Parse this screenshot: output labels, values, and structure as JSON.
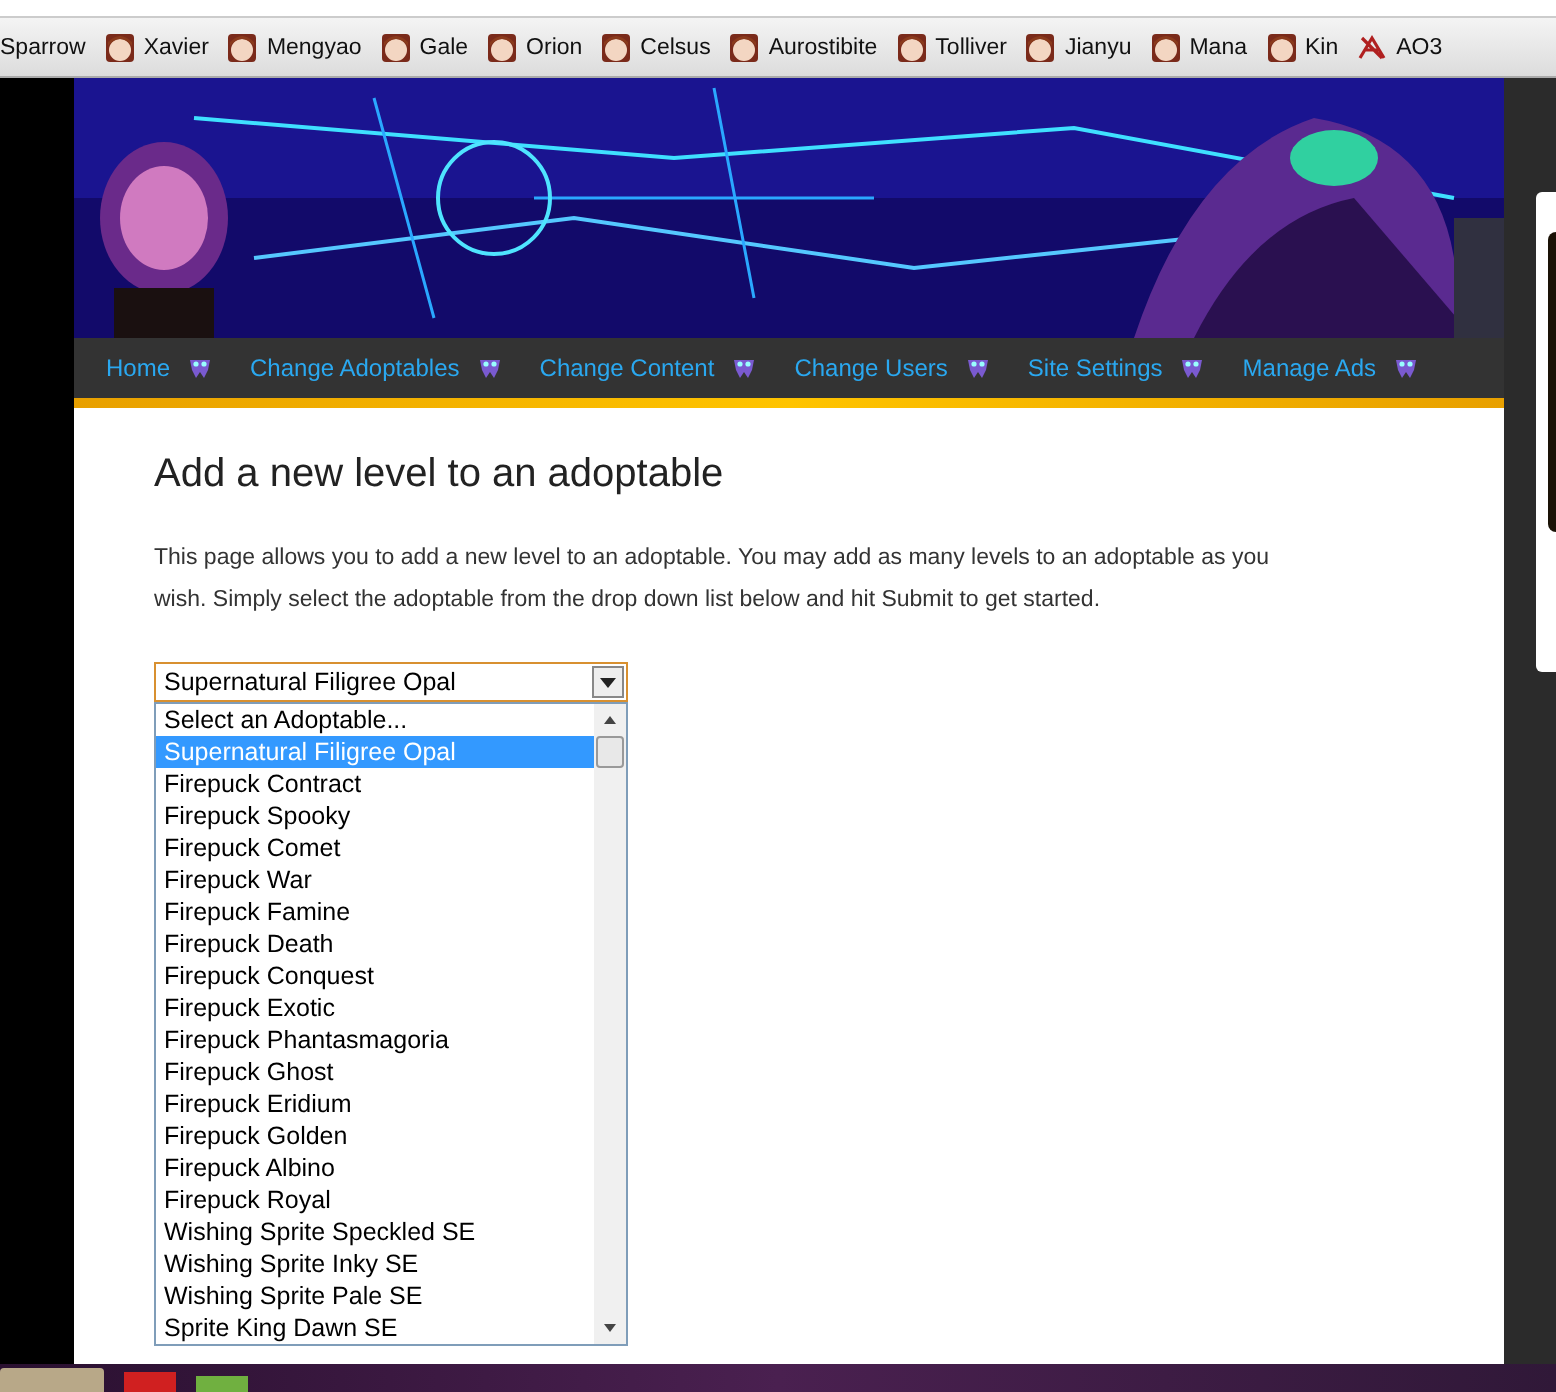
{
  "bookmarks": [
    {
      "label": "Sparrow",
      "kind": "plain"
    },
    {
      "label": "Xavier",
      "kind": "face"
    },
    {
      "label": "Mengyao",
      "kind": "face"
    },
    {
      "label": "Gale",
      "kind": "face"
    },
    {
      "label": "Orion",
      "kind": "face"
    },
    {
      "label": "Celsus",
      "kind": "face"
    },
    {
      "label": "Aurostibite",
      "kind": "face"
    },
    {
      "label": "Tolliver",
      "kind": "face"
    },
    {
      "label": "Jianyu",
      "kind": "face"
    },
    {
      "label": "Mana",
      "kind": "face"
    },
    {
      "label": "Kin",
      "kind": "face"
    },
    {
      "label": "AO3",
      "kind": "mark"
    }
  ],
  "nav": [
    "Home",
    "Change Adoptables",
    "Change Content",
    "Change Users",
    "Site Settings",
    "Manage Ads"
  ],
  "heading": "Add a new level to an adoptable",
  "intro": "This page allows you to add a new level to an adoptable. You may add as many levels to an adoptable as you wish. Simply select the adoptable from the drop down list below and hit Submit to get started.",
  "select": {
    "value": "Supernatural Filigree Opal",
    "expanded": true,
    "options": [
      {
        "label": "Select an Adoptable...",
        "selected": false
      },
      {
        "label": "Supernatural Filigree Opal",
        "selected": true
      },
      {
        "label": "Firepuck Contract",
        "selected": false
      },
      {
        "label": "Firepuck Spooky",
        "selected": false
      },
      {
        "label": "Firepuck Comet",
        "selected": false
      },
      {
        "label": "Firepuck War",
        "selected": false
      },
      {
        "label": "Firepuck Famine",
        "selected": false
      },
      {
        "label": "Firepuck Death",
        "selected": false
      },
      {
        "label": "Firepuck Conquest",
        "selected": false
      },
      {
        "label": "Firepuck Exotic",
        "selected": false
      },
      {
        "label": "Firepuck Phantasmagoria",
        "selected": false
      },
      {
        "label": "Firepuck Ghost",
        "selected": false
      },
      {
        "label": "Firepuck Eridium",
        "selected": false
      },
      {
        "label": "Firepuck Golden",
        "selected": false
      },
      {
        "label": "Firepuck Albino",
        "selected": false
      },
      {
        "label": "Firepuck Royal",
        "selected": false
      },
      {
        "label": "Wishing Sprite Speckled SE",
        "selected": false
      },
      {
        "label": "Wishing Sprite Inky SE",
        "selected": false
      },
      {
        "label": "Wishing Sprite Pale SE",
        "selected": false
      },
      {
        "label": "Sprite King Dawn SE",
        "selected": false
      }
    ]
  }
}
